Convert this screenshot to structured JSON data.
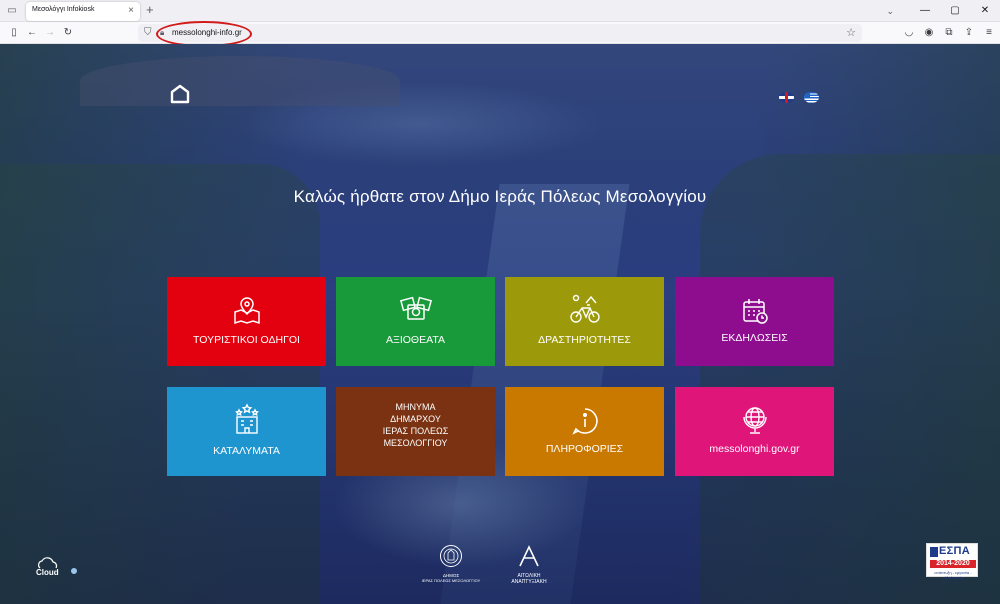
{
  "browser": {
    "tab_title": "Μεσολόγγι Infokiosk",
    "tab_close": "×",
    "new_tab": "+",
    "url": "messolonghi-info.gr",
    "window_controls": {
      "minimize": "—",
      "maximize": "▢",
      "close": "✕"
    }
  },
  "page": {
    "welcome": "Καλώς ήρθατε στον Δήμο Ιεράς Πόλεως Μεσολογγίου",
    "languages": [
      "English",
      "Ελληνικά"
    ],
    "tiles": [
      {
        "label": "ΤΟΥΡΙΣΤΙΚΟΙ ΟΔΗΓΟΙ",
        "color": "#e3000f",
        "icon": "map-pin-icon"
      },
      {
        "label": "ΑΞΙΟΘΕΑΤΑ",
        "color": "#199a3a",
        "icon": "photos-icon"
      },
      {
        "label": "ΔΡΑΣΤΗΡΙΟΤΗΤΕΣ",
        "color": "#9c9a0b",
        "icon": "bicycle-icon"
      },
      {
        "label": "ΕΚΔΗΛΩΣΕΙΣ",
        "color": "#8e0d8f",
        "icon": "calendar-icon"
      },
      {
        "label": "ΚΑΤΑΛΥΜΑΤΑ",
        "color": "#1f95d0",
        "icon": "hotel-icon"
      },
      {
        "label_lines": [
          "ΜΗΝΥΜΑ",
          "ΔΗΜΑΡΧΟΥ",
          "ΙΕΡΑΣ ΠΟΛΕΩΣ",
          "ΜΕΣΟΛΟΓΓΙΟΥ"
        ],
        "color": "#7a3212",
        "icon": ""
      },
      {
        "label": "ΠΛΗΡΟΦΟΡΙΕΣ",
        "color": "#c97800",
        "icon": "info-icon"
      },
      {
        "label": "messolonghi.gov.gr",
        "color": "#e0157a",
        "icon": "globe-icon"
      }
    ]
  },
  "footer": {
    "cloud_logo": "Cloud",
    "demos_logo_lines": [
      "ΔΗΜΟΣ",
      "ΙΕΡΑΣ ΠΟΛΕΩΣ ΜΕΣΟΛΟΓΓΙΟΥ"
    ],
    "aitoliki_logo_lines": [
      "ΑΙΤΩΛΙΚΗ",
      "ΑΝΑΠΤΥΞΙΑΚΗ"
    ],
    "espa": {
      "title": "ΕΣΠΑ",
      "years": "2014-2020",
      "tagline": "ανάπτυξη - εργασία - αλληλεγγύη"
    }
  }
}
